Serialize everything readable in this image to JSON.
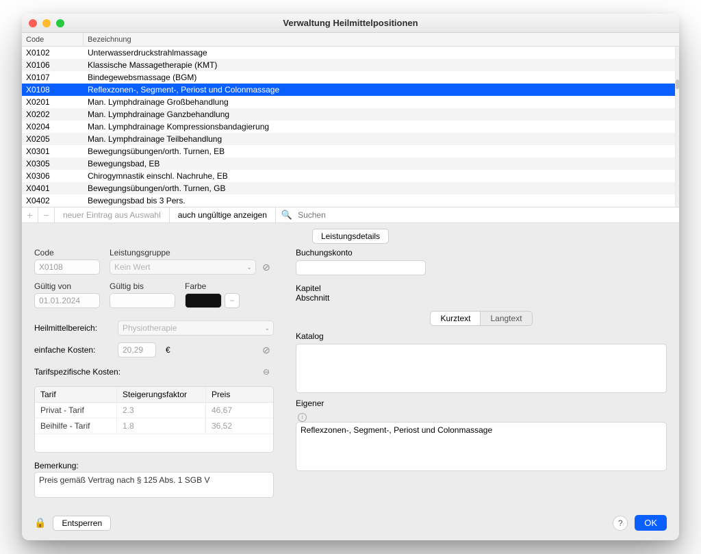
{
  "window": {
    "title": "Verwaltung Heilmittelpositionen"
  },
  "table": {
    "columns": [
      "Code",
      "Bezeichnung"
    ],
    "rows": [
      {
        "code": "X0102",
        "name": "Unterwasserdruckstrahlmassage"
      },
      {
        "code": "X0106",
        "name": "Klassische Massagetherapie (KMT)"
      },
      {
        "code": "X0107",
        "name": "Bindegewebsmassage (BGM)"
      },
      {
        "code": "X0108",
        "name": "Reflexzonen-, Segment-, Periost und Colonmassage",
        "selected": true
      },
      {
        "code": "X0201",
        "name": "Man. Lymphdrainage Großbehandlung"
      },
      {
        "code": "X0202",
        "name": "Man. Lymphdrainage Ganzbehandlung"
      },
      {
        "code": "X0204",
        "name": "Man. Lymphdrainage Kompressionsbandagierung"
      },
      {
        "code": "X0205",
        "name": "Man. Lymphdrainage Teilbehandlung"
      },
      {
        "code": "X0301",
        "name": "Bewegungsübungen/orth. Turnen, EB"
      },
      {
        "code": "X0305",
        "name": "Bewegungsbad, EB"
      },
      {
        "code": "X0306",
        "name": "Chirogymnastik einschl. Nachruhe, EB"
      },
      {
        "code": "X0401",
        "name": "Bewegungsübungen/orth. Turnen, GB"
      },
      {
        "code": "X0402",
        "name": "Bewegungsbad bis 3 Pers."
      }
    ]
  },
  "toolbar": {
    "add": "+",
    "remove": "−",
    "new_from_selection": "neuer Eintrag aus Auswahl",
    "show_invalid": "auch ungültige anzeigen",
    "search_placeholder": "Suchen"
  },
  "details": {
    "tab_label": "Leistungsdetails",
    "left": {
      "code_label": "Code",
      "code_value": "X0108",
      "leistungsgruppe_label": "Leistungsgruppe",
      "leistungsgruppe_value": "Kein Wert",
      "gueltig_von_label": "Gültig von",
      "gueltig_von_value": "01.01.2024",
      "gueltig_bis_label": "Gültig bis",
      "gueltig_bis_value": "",
      "farbe_label": "Farbe",
      "farbe_hex": "#111111",
      "heilmittelbereich_label": "Heilmittelbereich:",
      "heilmittelbereich_value": "Physiotherapie",
      "einfache_kosten_label": "einfache Kosten:",
      "einfache_kosten_value": "20,29",
      "currency": "€",
      "tarifkosten_label": "Tarifspezifische Kosten:",
      "tarif_headers": [
        "Tarif",
        "Steigerungsfaktor",
        "Preis"
      ],
      "tarif_rows": [
        {
          "name": "Privat - Tarif",
          "factor": "2.3",
          "price": "46,67"
        },
        {
          "name": "Beihilfe - Tarif",
          "factor": "1.8",
          "price": "36,52"
        }
      ],
      "bemerkung_label": "Bemerkung:",
      "bemerkung_value": "Preis gemäß Vertrag nach § 125 Abs. 1 SGB V"
    },
    "right": {
      "buchungskonto_label": "Buchungskonto",
      "buchungskonto_value": "",
      "kapitel_label": "Kapitel",
      "abschnitt_label": "Abschnitt",
      "tabs": {
        "kurztext": "Kurztext",
        "langtext": "Langtext",
        "active": "kurztext"
      },
      "katalog_label": "Katalog",
      "katalog_value": "",
      "eigener_label": "Eigener",
      "eigener_value": "Reflexzonen-, Segment-, Periost und Colonmassage"
    }
  },
  "footer": {
    "entsperren": "Entsperren",
    "ok": "OK"
  }
}
